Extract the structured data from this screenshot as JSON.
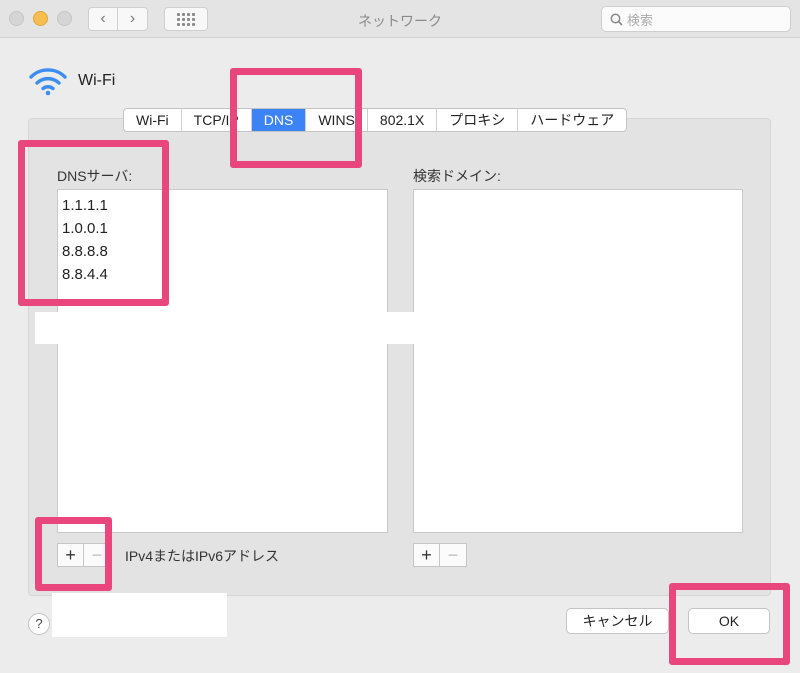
{
  "window": {
    "title": "ネットワーク"
  },
  "search": {
    "placeholder": "検索"
  },
  "interface": {
    "name": "Wi-Fi"
  },
  "tabs": [
    {
      "label": "Wi-Fi"
    },
    {
      "label": "TCP/IP"
    },
    {
      "label": "DNS"
    },
    {
      "label": "WINS"
    },
    {
      "label": "802.1X"
    },
    {
      "label": "プロキシ"
    },
    {
      "label": "ハードウェア"
    }
  ],
  "dns": {
    "label": "DNSサーバ:",
    "servers": [
      "1.1.1.1",
      "1.0.0.1",
      "8.8.8.8",
      "8.8.4.4"
    ],
    "hint": "IPv4またはIPv6アドレス"
  },
  "search_domains": {
    "label": "検索ドメイン:"
  },
  "buttons": {
    "add": "+",
    "remove": "−",
    "help": "?",
    "cancel": "キャンセル",
    "ok": "OK"
  },
  "colors": {
    "highlight": "#e8467c",
    "active_tab": "#3c83f5"
  }
}
